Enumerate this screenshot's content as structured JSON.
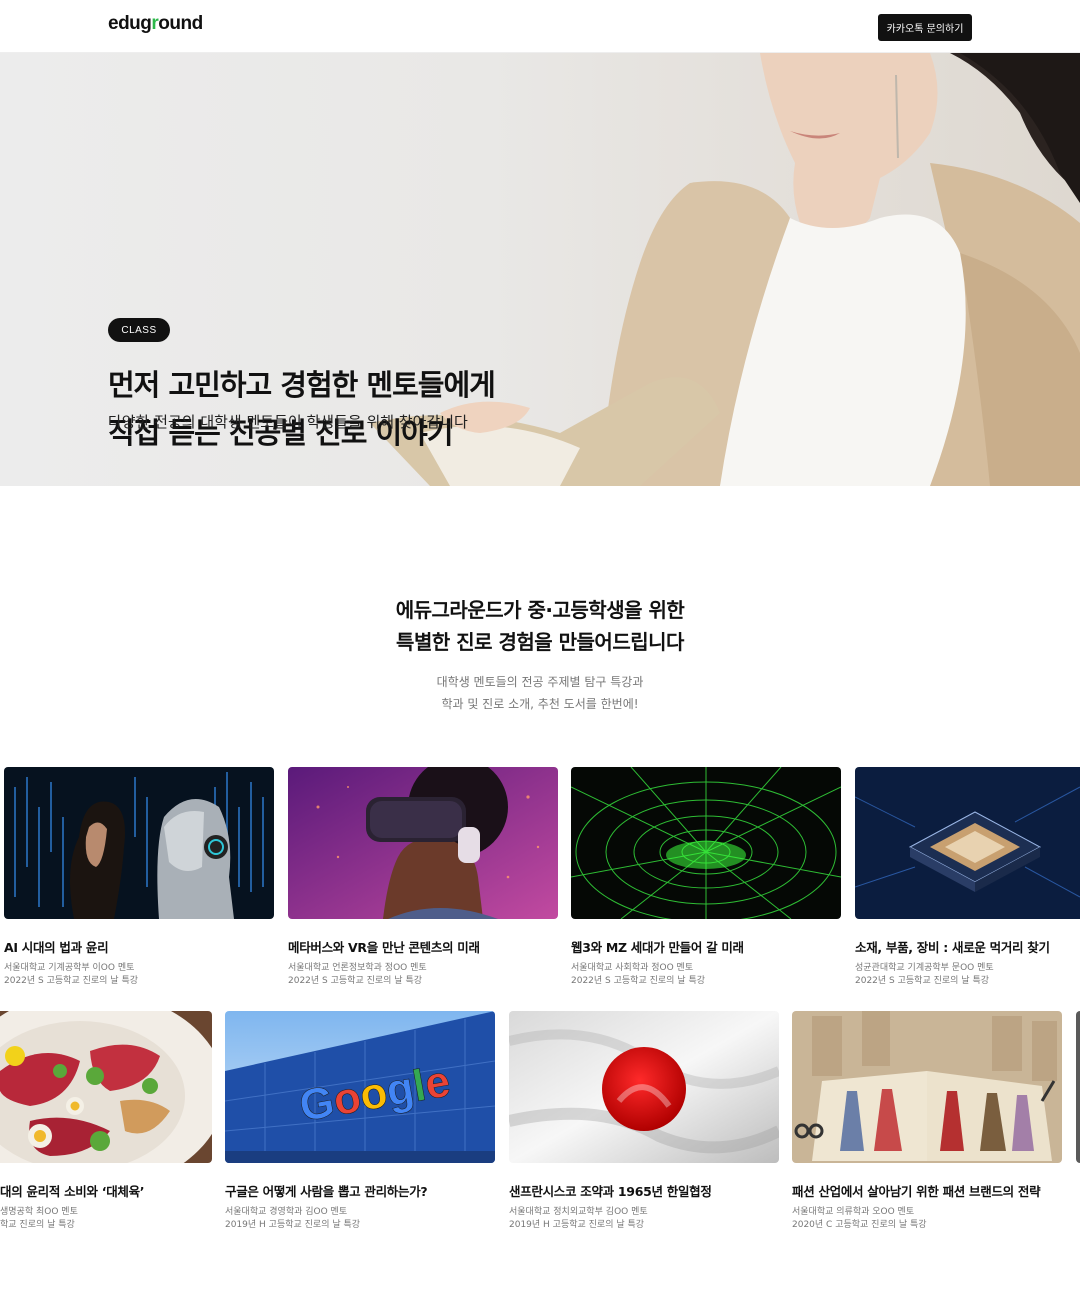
{
  "header": {
    "logo_text": "edugound",
    "kakao_button": "카카오톡 문의하기"
  },
  "hero": {
    "badge": "CLASS",
    "title_line1": "먼저 고민하고 경험한 멘토들에게",
    "title_line2": "직접 듣는 전공별 진로 이야기",
    "subtitle": "다양한 전공의 대학생 멘토들이 학생들을 위해 찾아갑니다"
  },
  "intro": {
    "title_line1": "에듀그라운드가 중·고등학생을 위한",
    "title_line2": "특별한 진로 경험을 만들어드립니다",
    "sub_line1": "대학생 멘토들의 전공 주제별 탐구 특강과",
    "sub_line2": "학과 및 진로 소개, 추천 도서를 한번에!"
  },
  "row1": [
    {
      "title": "AI 시대의 법과 윤리",
      "mentor": "서울대학교 기계공학부 이OO 멘토",
      "event": "2022년 S 고등학교 진로의 날 특강",
      "image": "ai-robot-image"
    },
    {
      "title": "메타버스와 VR을 만난 콘텐츠의 미래",
      "mentor": "서울대학교 언론정보학과 정OO 멘토",
      "event": "2022년 S 고등학교 진로의 날 특강",
      "image": "vr-headset-image"
    },
    {
      "title": "웹3와 MZ 세대가 만들어 갈 미래",
      "mentor": "서울대학교 사회학과 정OO 멘토",
      "event": "2022년 S 고등학교 진로의 날 특강",
      "image": "green-grid-image"
    },
    {
      "title": "소재, 부품, 장비 : 새로운 먹거리 찾기",
      "mentor": "성균관대학교 기계공학부 문OO 멘토",
      "event": "2022년 S 고등학교 진로의 날 특강",
      "image": "microchip-image"
    }
  ],
  "row2": [
    {
      "title": "대의 윤리적 소비와 ‘대체육’",
      "mentor": "생명공학 최OO 멘토",
      "event": "학교 진로의 날 특강",
      "image": "meat-platter-image"
    },
    {
      "title": "구글은 어떻게 사람을 뽑고 관리하는가?",
      "mentor": "서울대학교 경영학과 김OO 멘토",
      "event": "2019년 H 고등학교 진로의 날 특강",
      "image": "google-building-image"
    },
    {
      "title": "샌프란시스코 조약과 1965년 한일협정",
      "mentor": "서울대학교 정치외교학부 김OO 멘토",
      "event": "2019년 H 고등학교 진로의 날 특강",
      "image": "japan-flag-image"
    },
    {
      "title": "패션 산업에서 살아남기 위한 패션 브랜드의 전략",
      "mentor": "서울대학교 의류학과 오OO 멘토",
      "event": "2020년 C 고등학교 진로의 날 특강",
      "image": "fashion-book-image"
    }
  ],
  "google_text": "Google"
}
